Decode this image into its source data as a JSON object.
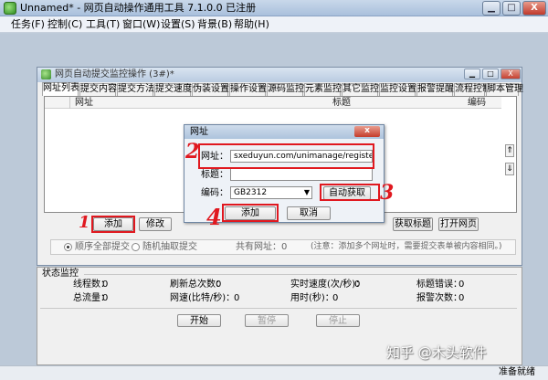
{
  "window": {
    "title": "Unnamed* - 网页自动操作通用工具 7.1.0.0 已注册",
    "min": "▁",
    "max": "□",
    "close": "X"
  },
  "menu": [
    "任务(F)",
    "控制(C)",
    "工具(T)",
    "窗口(W)",
    "设置(S)",
    "背景(B)",
    "帮助(H)"
  ],
  "child": {
    "title": "网页自动提交监控操作 (3#)*",
    "tabs": [
      "网址列表",
      "提交内容",
      "提交方法",
      "提交速度",
      "伪装设置",
      "操作设置",
      "源码监控",
      "元素监控",
      "其它监控",
      "监控设置",
      "报警提醒",
      "流程控制",
      "脚本管理"
    ],
    "columns": {
      "url": "网址",
      "title": "标题",
      "encoding": "编码"
    },
    "scroll_up": "⇑",
    "scroll_down": "⇓",
    "buttons": {
      "add": "添加",
      "edit": "修改",
      "fetch_title": "获取标题",
      "open_page": "打开网页"
    },
    "options": {
      "sequential": "顺序全部提交",
      "random": "随机抽取提交",
      "total": "共有网址：0",
      "note": "(注意：添加多个网址时，需要提交表单被内容相同。)"
    }
  },
  "status": {
    "label": "状态监控",
    "rows": [
      [
        [
          "线程数：",
          "0"
        ],
        [
          "刷新总次数：",
          "0"
        ],
        [
          "实时速度(次/秒)：",
          "0"
        ],
        [
          "标题错误：",
          "0"
        ]
      ],
      [
        [
          "总流量：",
          "0"
        ],
        [
          "网速(比特/秒)：",
          "0"
        ],
        [
          "用时(秒)：",
          "0"
        ],
        [
          "报警次数：",
          "0"
        ]
      ]
    ],
    "start": "开始",
    "pause": "暂停",
    "stop": "停止"
  },
  "dialog": {
    "title": "网址",
    "close": "x",
    "url_label": "网址：",
    "url_value": "sxeduyun.com/unimanage/register.html",
    "title_label": "标题：",
    "title_value": "",
    "encoding_label": "编码：",
    "encoding_value": "GB2312",
    "select_arrow": "▼",
    "auto_fetch": "自动获取",
    "add": "添加",
    "cancel": "取消"
  },
  "annotations": [
    "1",
    "2",
    "3",
    "4"
  ],
  "statusbar": {
    "ready": "准备就绪"
  },
  "watermark": "知乎 @木头软件",
  "colors": {
    "annotation": "#e0181f",
    "titlebar": "#b7cae0"
  }
}
